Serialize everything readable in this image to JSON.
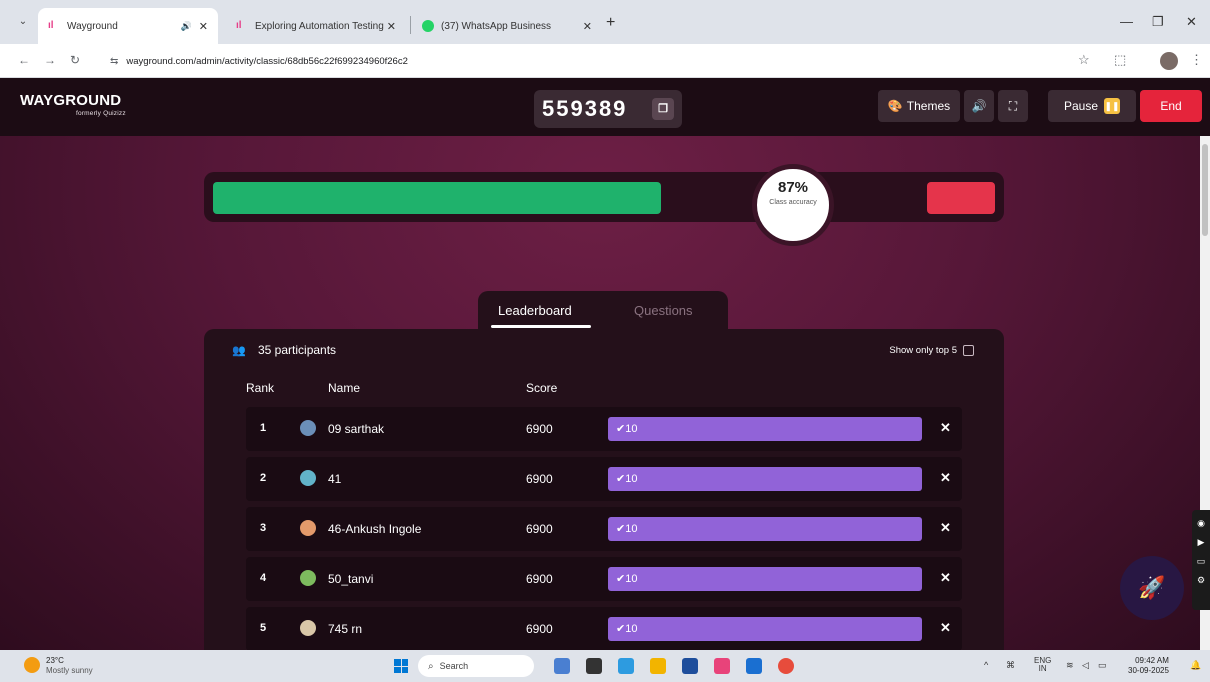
{
  "browser": {
    "tabs": [
      {
        "title": "Wayground",
        "active": true
      },
      {
        "title": "Exploring Automation Testing",
        "active": false
      },
      {
        "title": "(37) WhatsApp Business",
        "active": false
      }
    ],
    "url_site": "⇆",
    "url": "wayground.com/admin/activity/classic/68db56c22f699234960f26c2"
  },
  "header": {
    "logo": "WAYGROUND",
    "logo_sub": "formerly Quizizz",
    "game_code": "559389",
    "themes_label": "Themes",
    "pause_label": "Pause",
    "end_label": "End"
  },
  "accuracy": {
    "value_label": "87%",
    "caption": "Class accuracy",
    "correct_fraction": 0.87,
    "colors": {
      "correct": "#1fb26c",
      "incorrect": "#e5344b"
    }
  },
  "tabs": {
    "leaderboard": "Leaderboard",
    "questions": "Questions"
  },
  "leaderboard": {
    "participants_label": "35 participants",
    "top5_label": "Show only top 5",
    "col_rank": "Rank",
    "col_name": "Name",
    "col_score": "Score",
    "rows": [
      {
        "rank": "1",
        "name": "09 sarthak",
        "score": "6900",
        "correct": "10",
        "avatar_color": "#6b8fb8"
      },
      {
        "rank": "2",
        "name": "41",
        "score": "6900",
        "correct": "10",
        "avatar_color": "#62b3c9"
      },
      {
        "rank": "3",
        "name": "46-Ankush Ingole",
        "score": "6900",
        "correct": "10",
        "avatar_color": "#e39a6b"
      },
      {
        "rank": "4",
        "name": "50_tanvi",
        "score": "6900",
        "correct": "10",
        "avatar_color": "#7dbb5e"
      },
      {
        "rank": "5",
        "name": "745 rn",
        "score": "6900",
        "correct": "10",
        "avatar_color": "#d9c7a8"
      }
    ]
  },
  "taskbar": {
    "temp": "23°C",
    "weather": "Mostly sunny",
    "search_placeholder": "Search",
    "lang": "ENG",
    "lang_region": "IN",
    "time": "09:42 AM",
    "date": "30-09-2025"
  }
}
